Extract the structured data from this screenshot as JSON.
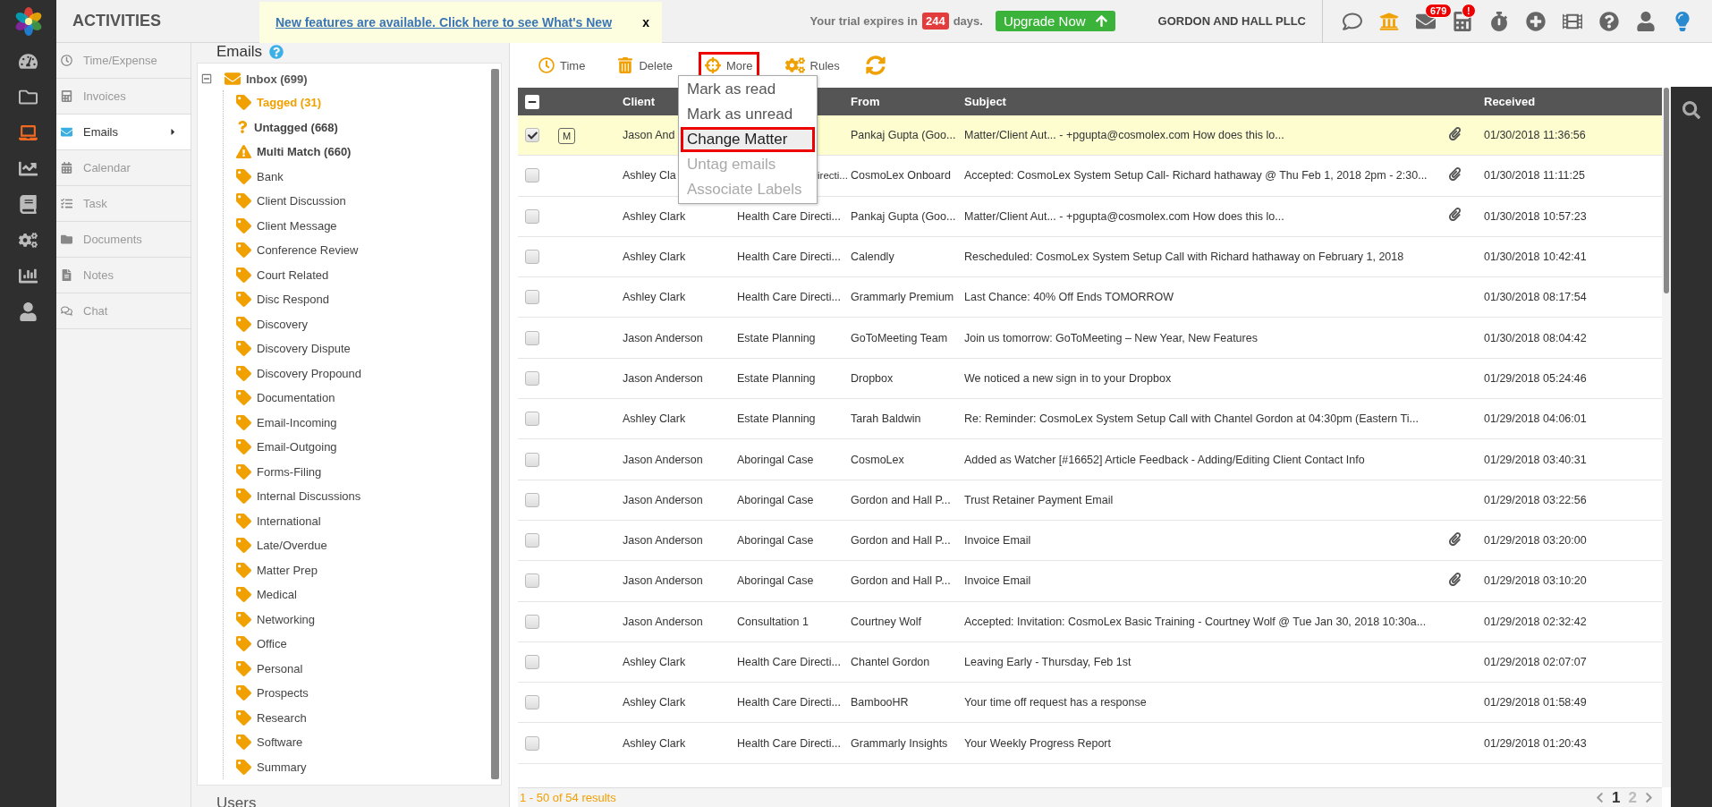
{
  "header": {
    "title": "ACTIVITIES",
    "banner_link": "New features are available. Click here to see What's New",
    "banner_close": "x",
    "trial_prefix": "Your trial expires in",
    "trial_days": "244",
    "trial_suffix": "days.",
    "upgrade": "Upgrade Now",
    "company": "GORDON AND HALL PLLC",
    "mail_badge": "679",
    "calculator_badge": "!"
  },
  "rail": [
    {
      "selected": false
    },
    {
      "selected": false
    },
    {
      "selected": true
    },
    {
      "selected": false
    },
    {
      "selected": false
    },
    {
      "selected": false
    },
    {
      "selected": false
    },
    {
      "selected": false
    }
  ],
  "nav": [
    {
      "label": "Time/Expense",
      "selected": false
    },
    {
      "label": "Invoices",
      "selected": false
    },
    {
      "label": "Emails",
      "selected": true
    },
    {
      "label": "Calendar",
      "selected": false
    },
    {
      "label": "Task",
      "selected": false
    },
    {
      "label": "Documents",
      "selected": false
    },
    {
      "label": "Notes",
      "selected": false
    },
    {
      "label": "Chat",
      "selected": false
    }
  ],
  "tree": {
    "title": "Emails",
    "root": {
      "label": "Inbox (699)",
      "expanded": true,
      "children": [
        {
          "label": "Tagged (31)",
          "kind": "tag",
          "selected": true
        },
        {
          "label": "Untagged (668)",
          "kind": "untagged",
          "selected": false
        },
        {
          "label": "Multi Match (660)",
          "kind": "multi",
          "selected": false
        },
        {
          "label": "Bank",
          "kind": "tag",
          "selected": false
        },
        {
          "label": "Client Discussion",
          "kind": "tag",
          "selected": false
        },
        {
          "label": "Client Message",
          "kind": "tag",
          "selected": false
        },
        {
          "label": "Conference Review",
          "kind": "tag",
          "selected": false
        },
        {
          "label": "Court Related",
          "kind": "tag",
          "selected": false
        },
        {
          "label": "Disc Respond",
          "kind": "tag",
          "selected": false
        },
        {
          "label": "Discovery",
          "kind": "tag",
          "selected": false
        },
        {
          "label": "Discovery Dispute",
          "kind": "tag",
          "selected": false
        },
        {
          "label": "Discovery Propound",
          "kind": "tag",
          "selected": false
        },
        {
          "label": "Documentation",
          "kind": "tag",
          "selected": false
        },
        {
          "label": "Email-Incoming",
          "kind": "tag",
          "selected": false
        },
        {
          "label": "Email-Outgoing",
          "kind": "tag",
          "selected": false
        },
        {
          "label": "Forms-Filing",
          "kind": "tag",
          "selected": false
        },
        {
          "label": "Internal Discussions",
          "kind": "tag",
          "selected": false
        },
        {
          "label": "International",
          "kind": "tag",
          "selected": false
        },
        {
          "label": "Late/Overdue",
          "kind": "tag",
          "selected": false
        },
        {
          "label": "Matter Prep",
          "kind": "tag",
          "selected": false
        },
        {
          "label": "Medical",
          "kind": "tag",
          "selected": false
        },
        {
          "label": "Networking",
          "kind": "tag",
          "selected": false
        },
        {
          "label": "Office",
          "kind": "tag",
          "selected": false
        },
        {
          "label": "Personal",
          "kind": "tag",
          "selected": false
        },
        {
          "label": "Prospects",
          "kind": "tag",
          "selected": false
        },
        {
          "label": "Research",
          "kind": "tag",
          "selected": false
        },
        {
          "label": "Software",
          "kind": "tag",
          "selected": false
        },
        {
          "label": "Summary",
          "kind": "tag",
          "selected": false
        }
      ]
    },
    "next_section": "Users"
  },
  "toolbar": [
    {
      "label": "Time",
      "highlighted": false
    },
    {
      "label": "Delete",
      "highlighted": false
    },
    {
      "label": "More",
      "highlighted": true
    },
    {
      "label": "Rules",
      "highlighted": false
    }
  ],
  "menu": [
    {
      "label": "Mark as read",
      "selected": false,
      "disabled": false
    },
    {
      "label": "Mark as unread",
      "selected": false,
      "disabled": false
    },
    {
      "label": "Change Matter",
      "selected": true,
      "disabled": false
    },
    {
      "label": "Untag emails",
      "selected": false,
      "disabled": true
    },
    {
      "label": "Associate Labels",
      "selected": false,
      "disabled": true
    }
  ],
  "table": {
    "select_all_partial": true,
    "columns": [
      {
        "label": "Client"
      },
      {
        "label": "From"
      },
      {
        "label": "Subject"
      },
      {
        "label": "Received"
      }
    ],
    "rows": [
      {
        "checked": true,
        "badge": "M",
        "client": "Jason And",
        "from": "Pankaj Gupta (Goo...",
        "subject": "Matter/Client Aut... - +pgupta@cosmolex.com How does this lo...",
        "attachment": true,
        "received": "01/30/2018 11:36:56"
      },
      {
        "checked": false,
        "client": "Ashley Cla",
        "matter": "irecti...",
        "from": "CosmoLex Onboard",
        "subject": "Accepted: CosmoLex System Setup Call- Richard hathaway @ Thu Feb 1, 2018 2pm - 2:30...",
        "attachment": true,
        "received": "01/30/2018 11:11:25"
      },
      {
        "checked": false,
        "client": "Ashley Clark",
        "matter": "Health Care Directi...",
        "from": "Pankaj Gupta (Goo...",
        "subject": "Matter/Client Aut... - +pgupta@cosmolex.com How does this lo...",
        "attachment": true,
        "received": "01/30/2018 10:57:23"
      },
      {
        "checked": false,
        "client": "Ashley Clark",
        "matter": "Health Care Directi...",
        "from": "Calendly",
        "subject": "Rescheduled: CosmoLex System Setup Call with Richard hathaway on February 1, 2018",
        "attachment": false,
        "received": "01/30/2018 10:42:41"
      },
      {
        "checked": false,
        "client": "Ashley Clark",
        "matter": "Health Care Directi...",
        "from": "Grammarly Premium",
        "subject": "Last Chance: 40% Off Ends TOMORROW",
        "attachment": false,
        "received": "01/30/2018 08:17:54"
      },
      {
        "checked": false,
        "client": "Jason Anderson",
        "matter": "Estate Planning",
        "from": "GoToMeeting Team",
        "subject": "Join us tomorrow: GoToMeeting – New Year, New Features",
        "attachment": false,
        "received": "01/30/2018 08:04:42"
      },
      {
        "checked": false,
        "client": "Jason Anderson",
        "matter": "Estate Planning",
        "from": "Dropbox",
        "subject": "We noticed a new sign in to your Dropbox",
        "attachment": false,
        "received": "01/29/2018 05:24:46"
      },
      {
        "checked": false,
        "client": "Ashley Clark",
        "matter": "Estate Planning",
        "from": "Tarah Baldwin",
        "subject": "Re: Reminder: CosmoLex System Setup Call with Chantel Gordon at 04:30pm (Eastern Ti...",
        "attachment": false,
        "received": "01/29/2018 04:06:01"
      },
      {
        "checked": false,
        "client": "Jason Anderson",
        "matter": "Aboringal Case",
        "from": "CosmoLex",
        "subject": "Added as Watcher [#16652] Article Feedback - Adding/Editing Client Contact Info",
        "attachment": false,
        "received": "01/29/2018 03:40:31"
      },
      {
        "checked": false,
        "client": "Jason Anderson",
        "matter": "Aboringal Case",
        "from": "Gordon and Hall P...",
        "subject": "Trust Retainer Payment Email",
        "attachment": false,
        "received": "01/29/2018 03:22:56"
      },
      {
        "checked": false,
        "client": "Jason Anderson",
        "matter": "Aboringal Case",
        "from": "Gordon and Hall P...",
        "subject": "Invoice Email",
        "attachment": true,
        "received": "01/29/2018 03:20:00"
      },
      {
        "checked": false,
        "client": "Jason Anderson",
        "matter": "Aboringal Case",
        "from": "Gordon and Hall P...",
        "subject": "Invoice Email",
        "attachment": true,
        "received": "01/29/2018 03:10:20"
      },
      {
        "checked": false,
        "client": "Jason Anderson",
        "matter": "Consultation 1",
        "from": "Courtney Wolf",
        "subject": "Accepted: Invitation: CosmoLex Basic Training - Courtney Wolf @ Tue Jan 30, 2018 10:30a...",
        "attachment": false,
        "received": "01/29/2018 02:32:42"
      },
      {
        "checked": false,
        "client": "Ashley Clark",
        "matter": "Health Care Directi...",
        "from": "Chantel Gordon",
        "subject": "Leaving Early - Thursday, Feb 1st",
        "attachment": false,
        "received": "01/29/2018 02:07:07"
      },
      {
        "checked": false,
        "client": "Ashley Clark",
        "matter": "Health Care Directi...",
        "from": "BambooHR",
        "subject": "Your time off request has a response",
        "attachment": false,
        "received": "01/29/2018 01:58:49"
      },
      {
        "checked": false,
        "client": "Ashley Clark",
        "matter": "Health Care Directi...",
        "from": "Grammarly Insights",
        "subject": "Your Weekly Progress Report",
        "attachment": false,
        "received": "01/29/2018 01:20:43"
      }
    ]
  },
  "footer": {
    "summary": "1 - 50 of 54 results",
    "pages": [
      {
        "label": "1",
        "selected": true
      },
      {
        "label": "2",
        "selected": false
      }
    ]
  }
}
